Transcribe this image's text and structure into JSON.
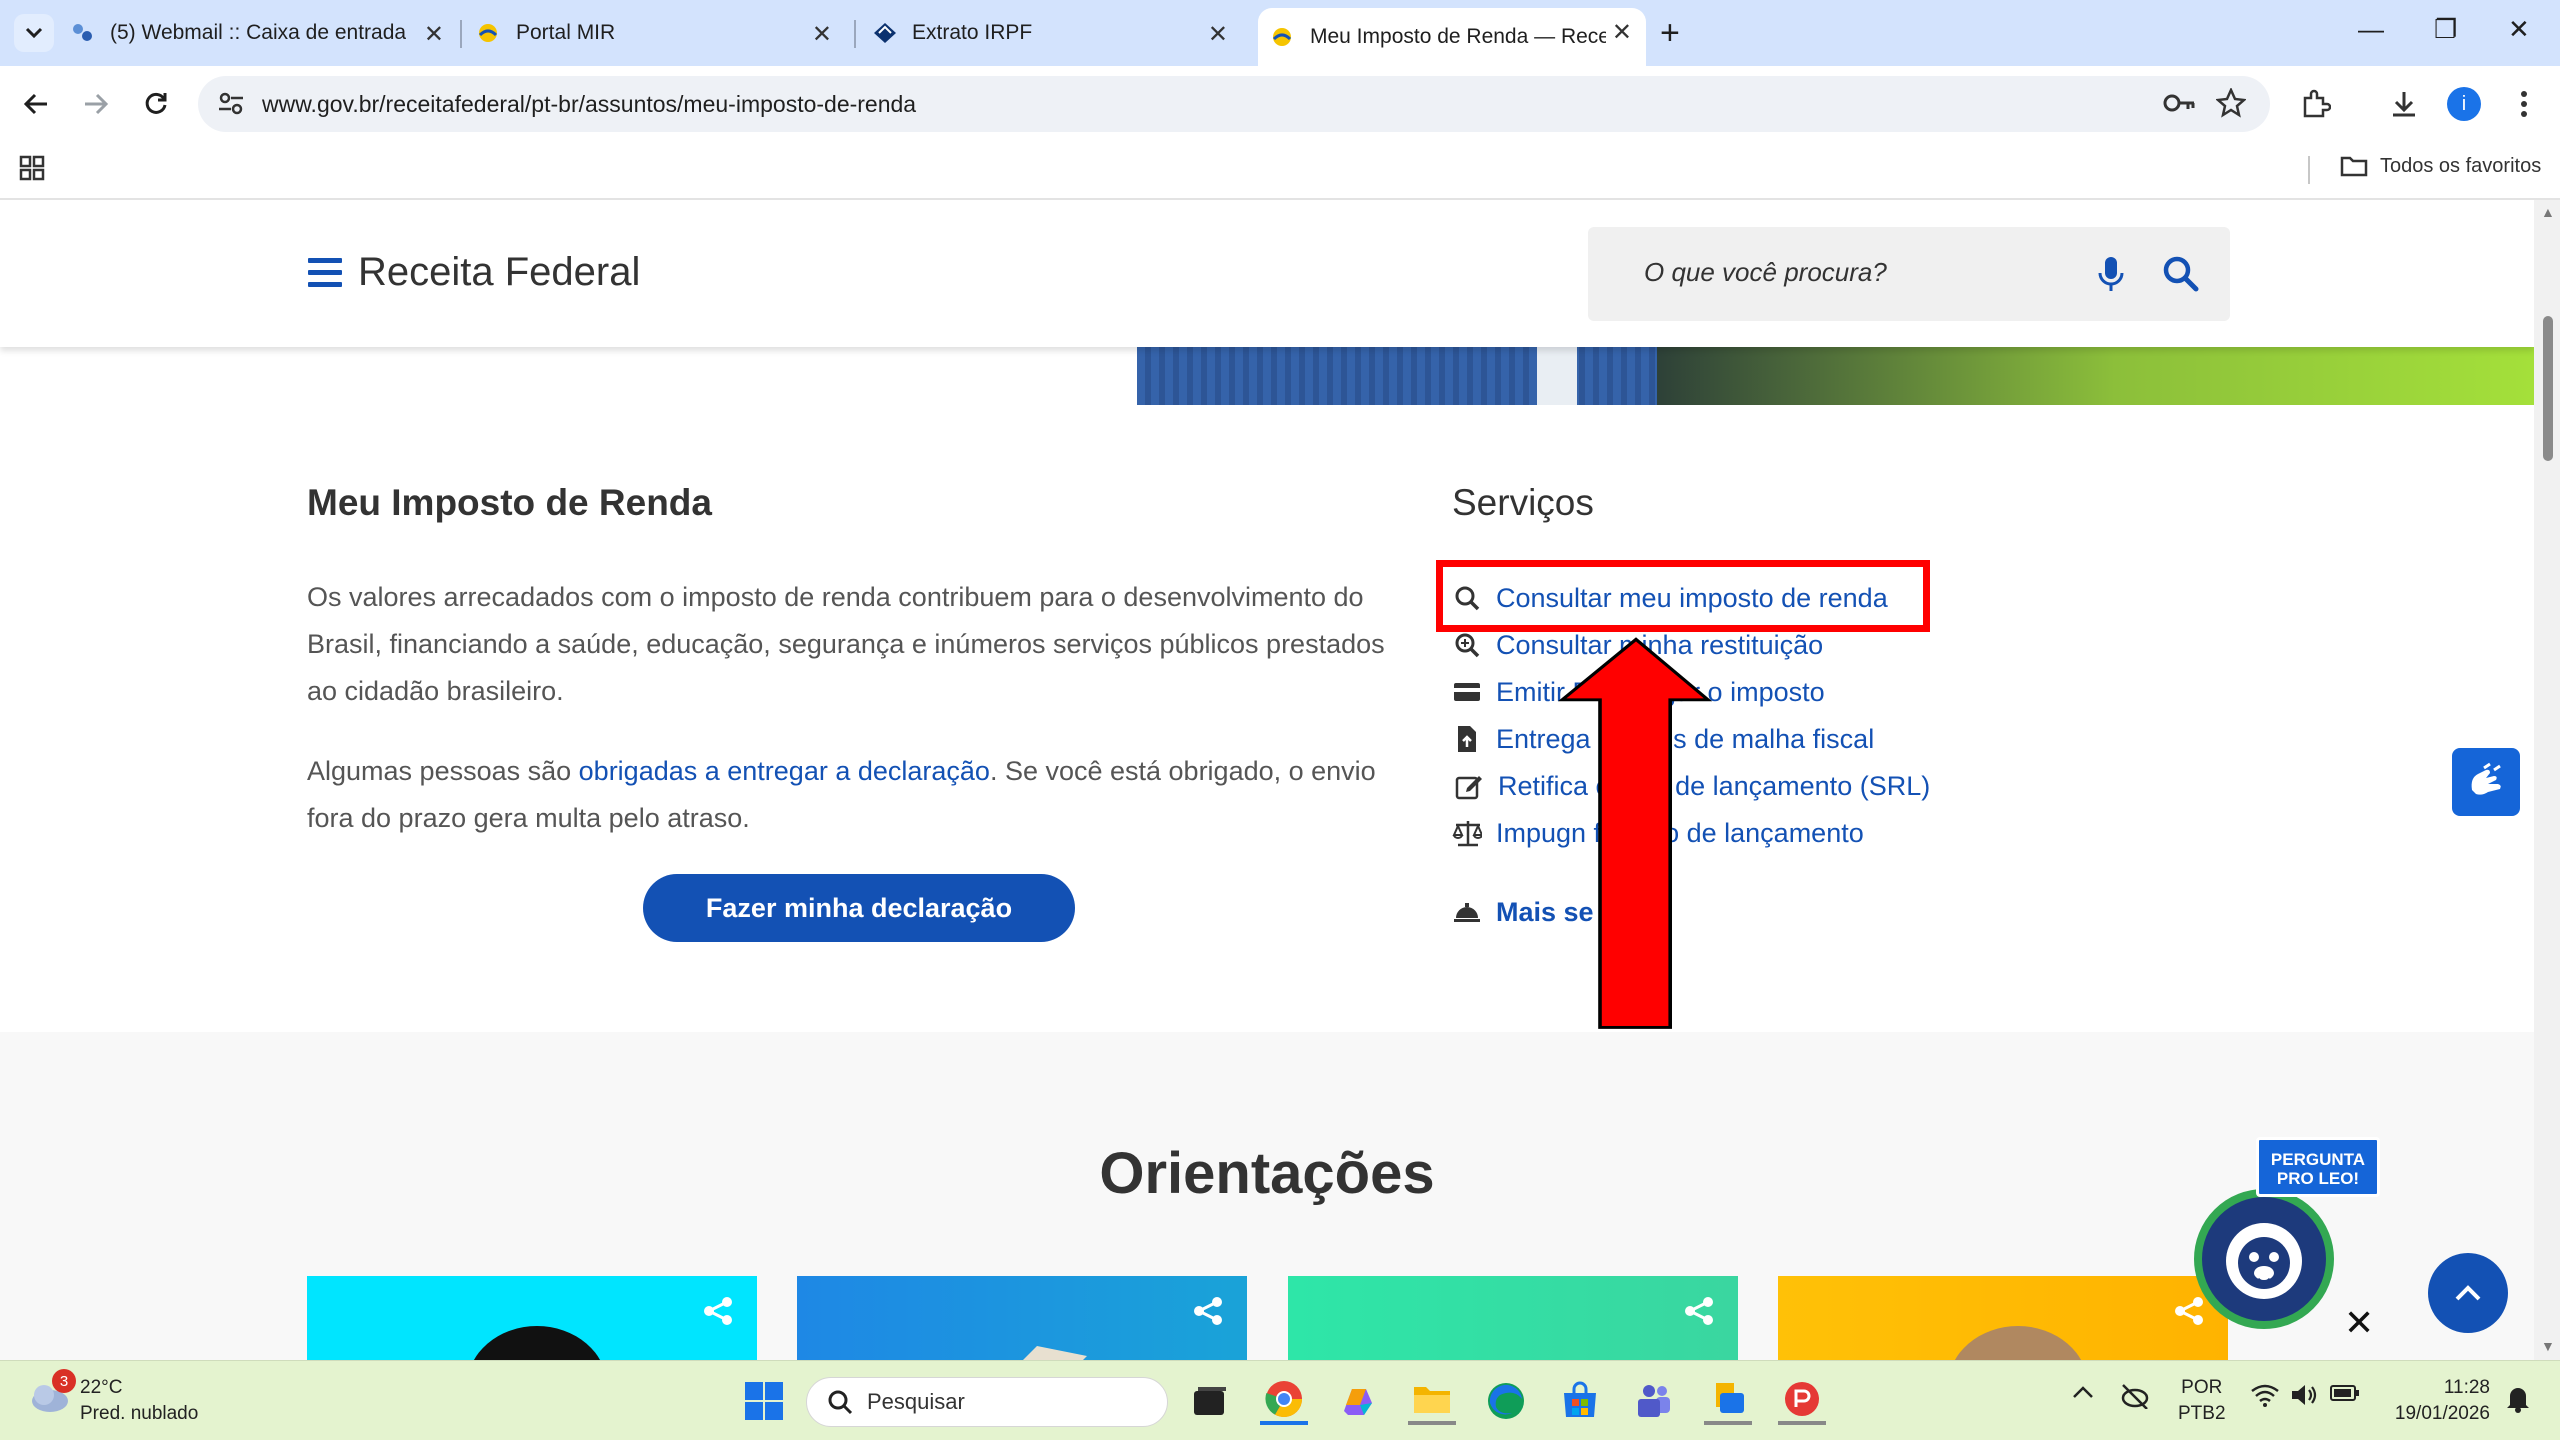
{
  "browser": {
    "tabs": [
      {
        "label": "(5) Webmail :: Caixa de entrada",
        "icon": "webmail-icon"
      },
      {
        "label": "Portal MIR",
        "icon": "gov-icon"
      },
      {
        "label": "Extrato IRPF",
        "icon": "receita-icon"
      },
      {
        "label": "Meu Imposto de Renda — Rece",
        "icon": "gov-icon",
        "active": true
      }
    ],
    "url": "www.gov.br/receitafederal/pt-br/assuntos/meu-imposto-de-renda",
    "profile_initial": "i",
    "bookmarks_label": "Todos os favoritos"
  },
  "site": {
    "brand": "Receita Federal",
    "search_placeholder": "O que você procura?"
  },
  "main": {
    "title": "Meu Imposto de Renda",
    "paragraph1": "Os valores arrecadados com o imposto de renda contribuem para o desenvolvimento do Brasil, financiando a saúde, educação, segurança e inúmeros serviços públicos prestados ao cidadão brasileiro.",
    "paragraph2_pre": "Algumas pessoas são ",
    "paragraph2_link": "obrigadas a entregar a declaração",
    "paragraph2_post": ". Se você está obrigado, o envio fora do prazo gera multa pelo atraso.",
    "cta_label": "Fazer minha declaração"
  },
  "services": {
    "title": "Serviços",
    "items": [
      {
        "label": "Consultar meu imposto de renda",
        "icon": "search-icon"
      },
      {
        "label": "Consultar minha restituição",
        "icon": "zoom-search-icon"
      },
      {
        "label": "Emitir D        ra pagar o imposto",
        "icon": "card-icon"
      },
      {
        "label": "Entrega        mentos de malha fiscal",
        "icon": "file-upload-icon"
      },
      {
        "label": "Retifica        cação de lançamento (SRL)",
        "icon": "edit-icon"
      },
      {
        "label": "Impugn        ficação de lançamento",
        "icon": "scale-icon"
      }
    ],
    "more_label": "Mais se        ."
  },
  "orientacoes": {
    "title": "Orientações",
    "cards": [
      {
        "color": "#00e5ff"
      },
      {
        "color": "#1e88e5"
      },
      {
        "color": "#2ee6a8"
      },
      {
        "color": "#ffc107"
      }
    ]
  },
  "leo": {
    "badge": "PERGUNTA PRO LEO!"
  },
  "taskbar": {
    "weather_temp": "22°C",
    "weather_desc": "Pred. nublado",
    "weather_badge": "3",
    "search_label": "Pesquisar",
    "lang_line1": "POR",
    "lang_line2": "PTB2",
    "time": "11:28",
    "date": "19/01/2026"
  }
}
